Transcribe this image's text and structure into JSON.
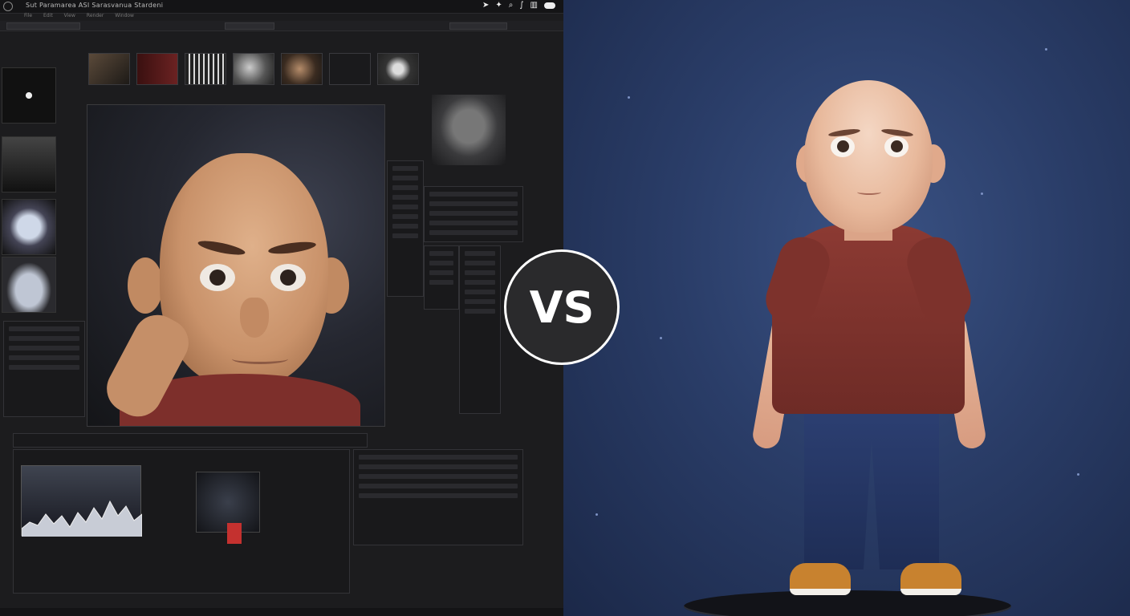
{
  "app": {
    "menu_title": "Sut Paramarea  ASI  Sarasvanua  Stardeni",
    "tabs": [
      "File",
      "Edit",
      "View",
      "Render",
      "Window"
    ]
  },
  "comparison": {
    "badge_label": "VS"
  },
  "colors": {
    "editor_bg": "#1c1c1e",
    "showcase_bg": "#2a3d68",
    "shirt": "#8c3a33",
    "pants": "#2c3f72",
    "shoes": "#c8822f"
  },
  "icons": {
    "menu_tools": [
      "arrow-icon",
      "wand-icon",
      "search-icon",
      "graph-icon",
      "book-icon",
      "toggle-icon"
    ]
  }
}
